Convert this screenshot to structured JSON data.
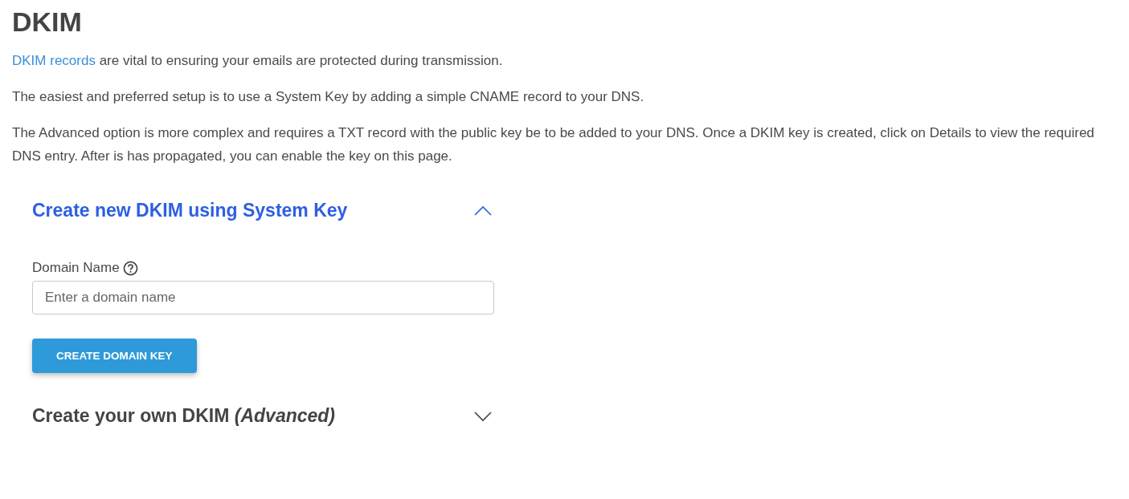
{
  "title": "DKIM",
  "intro": {
    "link": "DKIM records",
    "text": " are vital to ensuring your emails are protected during transmission."
  },
  "paragraphs": [
    "The easiest and preferred setup is to use a System Key by adding a simple CNAME record to your DNS.",
    "The Advanced option is more complex and requires a TXT record with the public key be to be added to your DNS. Once a DKIM key is created, click on Details to view the required DNS entry. After is has propagated, you can enable the key on this page."
  ],
  "sections": [
    {
      "title": "Create new DKIM using System Key",
      "expanded": true,
      "field": {
        "label": "Domain Name",
        "placeholder": "Enter a domain name"
      },
      "button": "CREATE DOMAIN KEY"
    },
    {
      "title": "Create your own DKIM *(Advanced)*",
      "expanded": false
    }
  ]
}
